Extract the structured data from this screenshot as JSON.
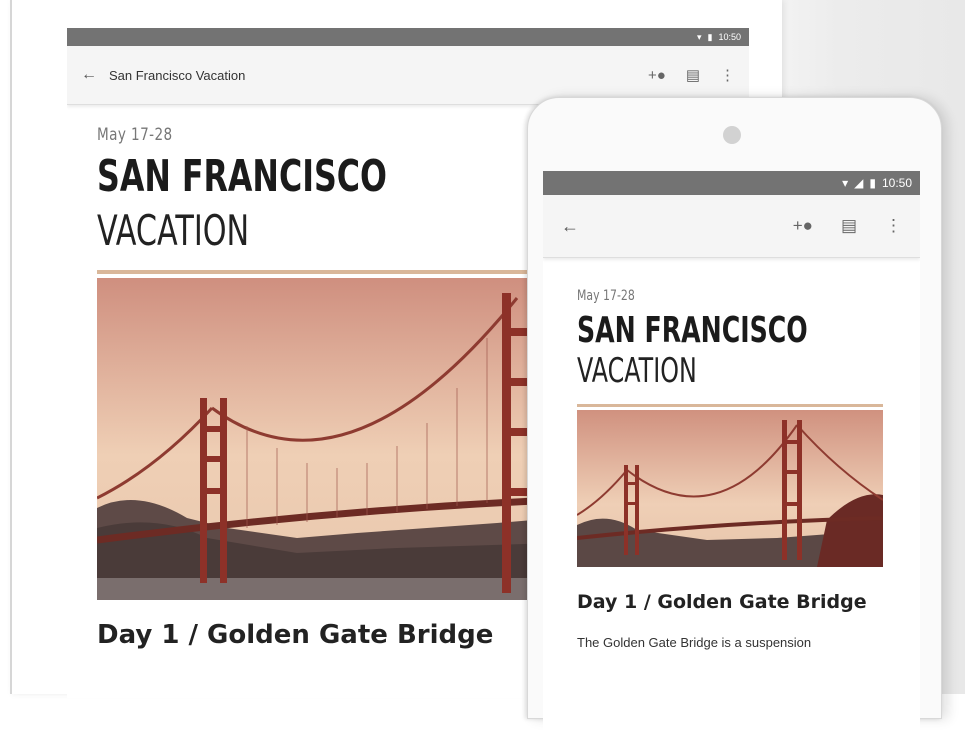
{
  "tablet": {
    "status_time": "10:50",
    "status_icons": [
      "wifi-icon",
      "battery-icon"
    ],
    "app_title": "San Francisco Vacation",
    "actions": [
      "add-person-icon",
      "comment-icon",
      "more-vert-icon"
    ],
    "doc": {
      "date": "May 17-28",
      "headline_line1": "SAN FRANCISCO",
      "headline_line2": "VACATION",
      "section_title": "Day 1 / Golden Gate Bridge"
    }
  },
  "phone": {
    "status_time": "10:50",
    "status_icons": [
      "wifi-icon",
      "signal-icon",
      "battery-icon"
    ],
    "actions": [
      "add-person-icon",
      "comment-icon",
      "more-vert-icon"
    ],
    "doc": {
      "date": "May 17-28",
      "headline_line1": "SAN FRANCISCO",
      "headline_line2": "VACATION",
      "section_title": "Day 1 / Golden Gate Bridge",
      "body_text": "The Golden Gate Bridge is a suspension"
    }
  },
  "colors": {
    "status_bar": "#737373",
    "app_bar": "#f5f5f5",
    "accent_rule": "#d9b79a",
    "sky_top": "#d79a86",
    "sky_bottom": "#f0d6bd",
    "bridge": "#9a3a2e"
  }
}
